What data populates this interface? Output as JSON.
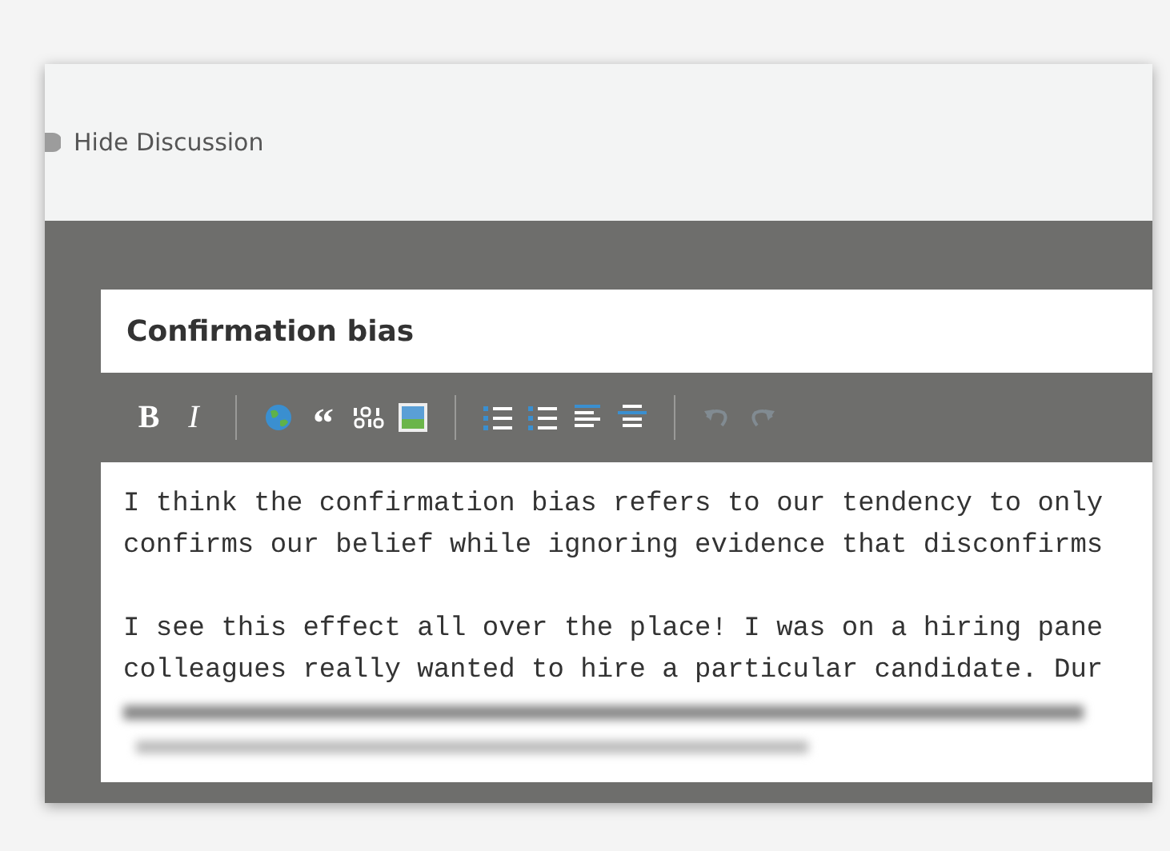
{
  "header": {
    "toggle_label": "Hide Discussion"
  },
  "editor": {
    "title_value": "Confirmation bias",
    "toolbar": [
      {
        "kind": "bold",
        "label": "B"
      },
      {
        "kind": "italic",
        "label": "I"
      },
      {
        "kind": "divider"
      },
      {
        "kind": "link"
      },
      {
        "kind": "quote",
        "label": "“"
      },
      {
        "kind": "code"
      },
      {
        "kind": "image"
      },
      {
        "kind": "divider"
      },
      {
        "kind": "ordered-list"
      },
      {
        "kind": "bullet-list"
      },
      {
        "kind": "align"
      },
      {
        "kind": "rule"
      },
      {
        "kind": "divider"
      },
      {
        "kind": "undo",
        "disabled": true
      },
      {
        "kind": "redo",
        "disabled": true
      }
    ],
    "paragraphs": [
      [
        "I think the confirmation bias refers to our tendency to only",
        "confirms our belief while ignoring evidence that disconfirms"
      ],
      [
        "I see this effect all over the place! I was on a hiring pane",
        "colleagues really wanted to hire a particular candidate. Dur"
      ]
    ]
  }
}
